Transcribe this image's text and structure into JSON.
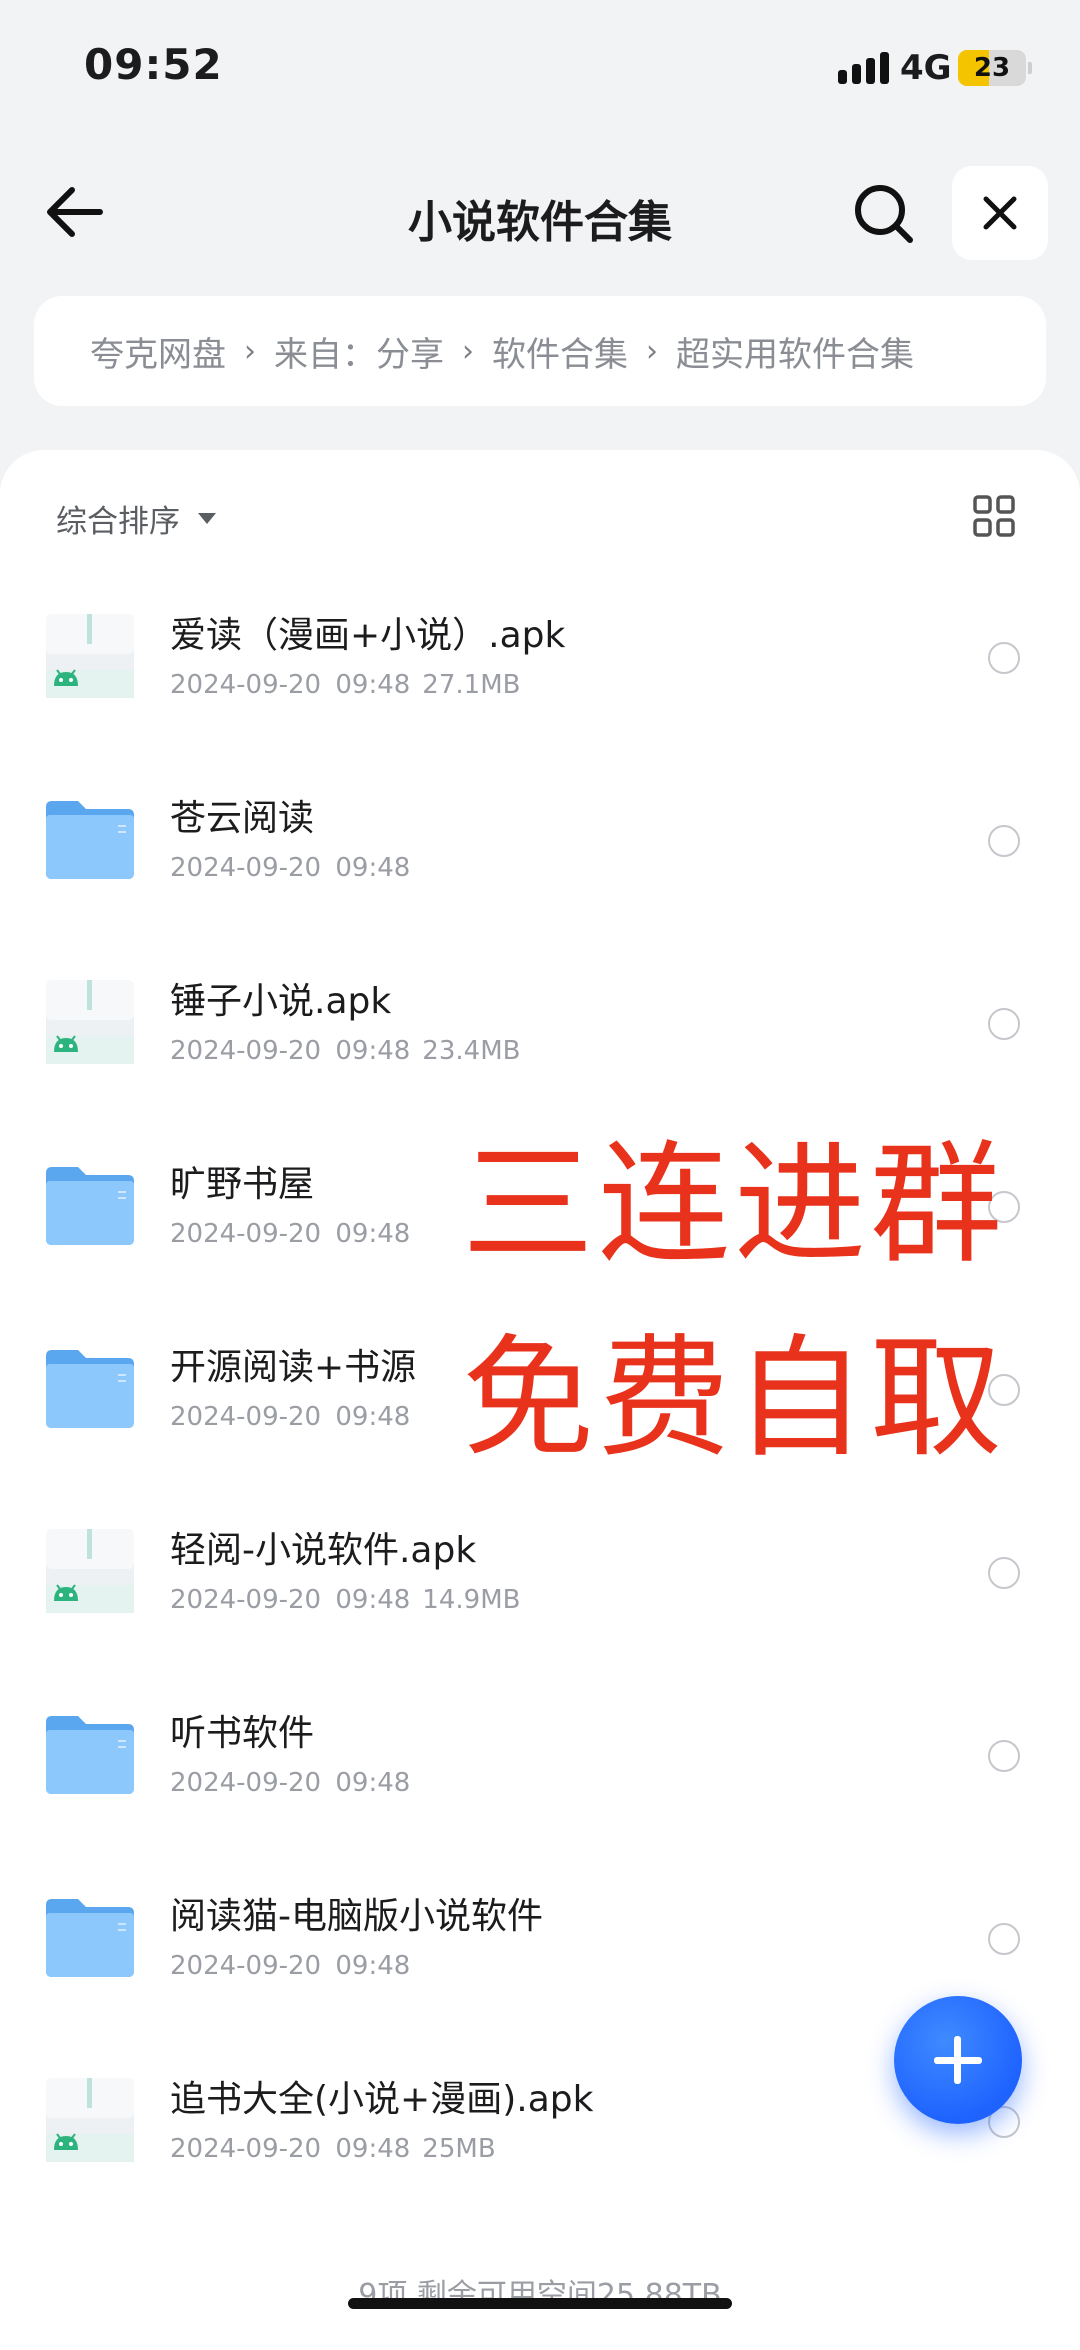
{
  "status": {
    "time": "09:52",
    "network": "4G",
    "battery": "23"
  },
  "nav": {
    "title": "小说软件合集"
  },
  "breadcrumb": [
    "夸克网盘",
    "来自：分享",
    "软件合集",
    "超实用软件合集"
  ],
  "toolbar": {
    "sort_label": "综合排序"
  },
  "files": [
    {
      "type": "apk",
      "name": "爱读（漫画+小说）.apk",
      "date": "2024-09-20 09:48",
      "size": "27.1MB"
    },
    {
      "type": "folder",
      "name": "苍云阅读",
      "date": "2024-09-20 09:48",
      "size": ""
    },
    {
      "type": "apk",
      "name": "锤子小说.apk",
      "date": "2024-09-20 09:48",
      "size": "23.4MB"
    },
    {
      "type": "folder",
      "name": "旷野书屋",
      "date": "2024-09-20 09:48",
      "size": ""
    },
    {
      "type": "folder",
      "name": "开源阅读+书源",
      "date": "2024-09-20 09:48",
      "size": ""
    },
    {
      "type": "apk",
      "name": "轻阅-小说软件.apk",
      "date": "2024-09-20 09:48",
      "size": "14.9MB"
    },
    {
      "type": "folder",
      "name": "听书软件",
      "date": "2024-09-20 09:48",
      "size": ""
    },
    {
      "type": "folder",
      "name": "阅读猫-电脑版小说软件",
      "date": "2024-09-20 09:48",
      "size": ""
    },
    {
      "type": "apk",
      "name": "追书大全(小说+漫画).apk",
      "date": "2024-09-20 09:48",
      "size": "25MB"
    }
  ],
  "overlay": {
    "line1": "三连进群",
    "line2": "免费自取"
  },
  "footer": {
    "summary": "9项 剩余可用空间25.88TB"
  },
  "colors": {
    "accent": "#1f63ff",
    "overlay_red": "#e8321b",
    "folder_blue": "#6db3f5"
  }
}
